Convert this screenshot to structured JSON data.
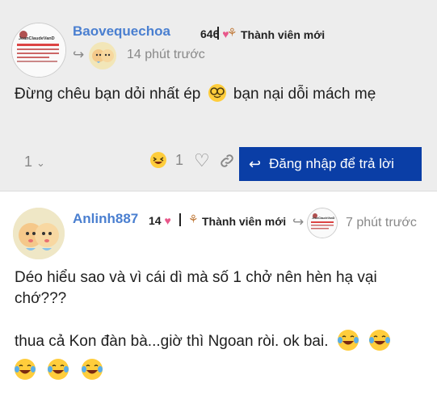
{
  "posts": [
    {
      "username": "Baovequechoa",
      "likes": "646",
      "title": "Thành viên mới",
      "time": "14 phút trước",
      "body": "Đừng chêu bạn dỏi nhất ép",
      "body_after_emoji": "bạn nại dỗi mách mẹ",
      "emoji_name": "nerd-face",
      "avatar_text": "JeanClaudeVanD",
      "footer": {
        "replies": "1",
        "reaction_count": "1",
        "login_reply_label": "Đăng nhập để trả lời"
      }
    },
    {
      "username": "Anlinh887",
      "likes": "14",
      "title": "Thành viên mới",
      "time": "7 phút trước",
      "para1": "Déo hiểu sao và vì cái dì mà số 1 chở nên hèn hạ vại chớ???",
      "para2": "thua cả Kon đàn bà...giờ thì Ngoan ròi. ok bai.",
      "emoji_name": "tears-of-joy",
      "reply_to_avatar_text": "JeanClaudeVanD"
    }
  ],
  "colors": {
    "username": "#4a7fd0",
    "heart": "#e8578a",
    "cta": "#0a3ea6",
    "post_bg": "#ededed"
  }
}
